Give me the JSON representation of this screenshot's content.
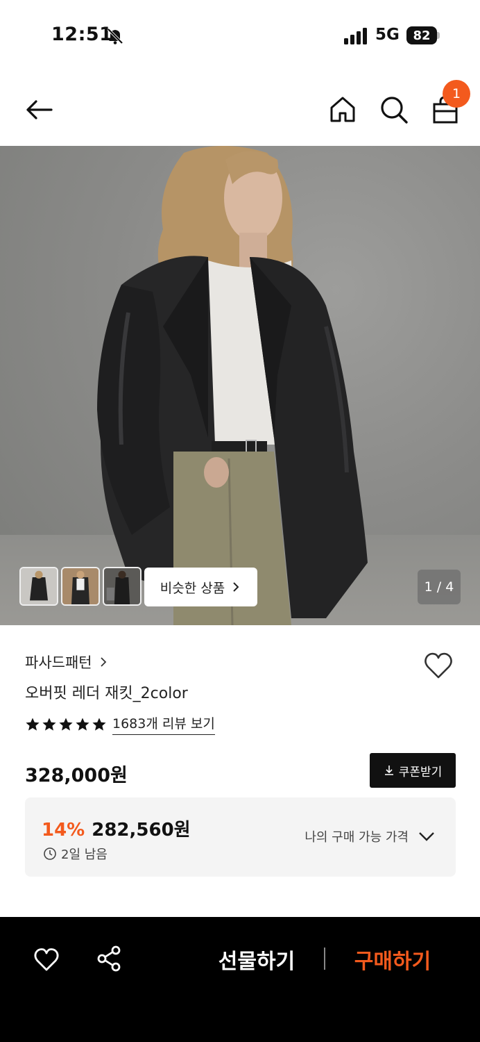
{
  "status_bar": {
    "time": "12:51",
    "network": "5G",
    "battery": "82"
  },
  "header": {
    "cart_count": "1"
  },
  "gallery": {
    "similar_label": "비슷한 상품",
    "page_indicator": "1 / 4"
  },
  "product": {
    "brand": "파사드패턴",
    "title": "오버핏 레더 재킷_2color",
    "rating_stars": 5,
    "review_link": "1683개 리뷰 보기",
    "price": "328,000원",
    "coupon_label": "쿠폰받기"
  },
  "discount": {
    "rate": "14%",
    "price": "282,560원",
    "timer": "2일 남음",
    "my_price_label": "나의 구매 가능 가격"
  },
  "bottom_bar": {
    "gift_label": "선물하기",
    "buy_label": "구매하기"
  },
  "colors": {
    "accent": "#f35a1d",
    "bar_bg": "#000000",
    "box_bg": "#f4f4f4"
  }
}
